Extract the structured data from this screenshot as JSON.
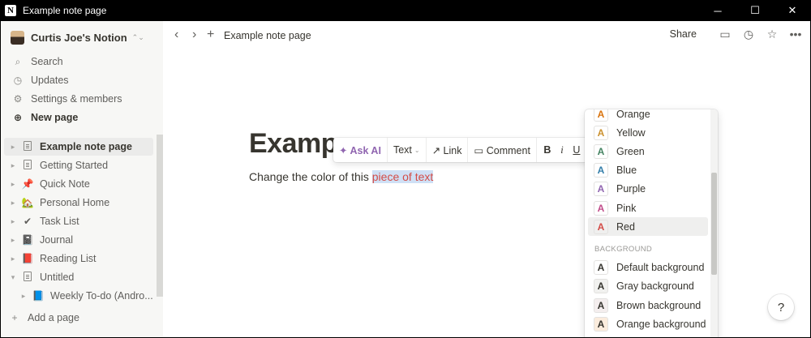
{
  "window": {
    "title": "Example note page",
    "app_icon": "N",
    "controls": {
      "minimize": "─",
      "maximize": "☐",
      "close": "✕"
    }
  },
  "sidebar": {
    "workspace_name": "Curtis Joe's Notion",
    "workspace_chevron": "⌃⌄",
    "top_items": [
      {
        "label": "Search",
        "icon": "search-icon",
        "glyph": "⌕"
      },
      {
        "label": "Updates",
        "icon": "clock-icon",
        "glyph": "◷"
      },
      {
        "label": "Settings & members",
        "icon": "gear-icon",
        "glyph": "⚙"
      },
      {
        "label": "New page",
        "icon": "plus-circle-icon",
        "glyph": "⊕"
      }
    ],
    "pages": [
      {
        "label": "Example note page",
        "glyph": "",
        "active": true
      },
      {
        "label": "Getting Started",
        "glyph": ""
      },
      {
        "label": "Quick Note",
        "glyph": "📌"
      },
      {
        "label": "Personal Home",
        "glyph": "🏡"
      },
      {
        "label": "Task List",
        "glyph": "✔"
      },
      {
        "label": "Journal",
        "glyph": "📓"
      },
      {
        "label": "Reading List",
        "glyph": "📕"
      },
      {
        "label": "Untitled",
        "glyph": ""
      },
      {
        "label": "Weekly To-do (Andro...",
        "glyph": "📘"
      }
    ],
    "add_page": "Add a page",
    "add_glyph": "+"
  },
  "topbar": {
    "back": "‹",
    "forward": "›",
    "new": "+",
    "breadcrumb": "Example note page",
    "share": "Share",
    "icons": {
      "comments": "▭",
      "history": "◷",
      "favorite": "☆",
      "more": "•••"
    }
  },
  "page": {
    "title": "Examp",
    "body_prefix": "Change the color of this ",
    "body_selected": "piece of text"
  },
  "format_toolbar": {
    "ask_ai": "✦ Ask AI",
    "text_type": "Text",
    "type_chevron": "⌄",
    "link": "↗ Link",
    "comment": "▭ Comment",
    "bold": "B",
    "italic": "i",
    "underline": "U"
  },
  "color_menu": {
    "swatch_letter": "A",
    "text_colors": [
      {
        "label": "Orange",
        "color": "#d9730d"
      },
      {
        "label": "Yellow",
        "color": "#cb912f"
      },
      {
        "label": "Green",
        "color": "#448361"
      },
      {
        "label": "Blue",
        "color": "#337ea9"
      },
      {
        "label": "Purple",
        "color": "#9065b0"
      },
      {
        "label": "Pink",
        "color": "#c14c8a"
      },
      {
        "label": "Red",
        "color": "#d44c47",
        "hover": true
      }
    ],
    "background_header": "BACKGROUND",
    "background_colors": [
      {
        "label": "Default background",
        "bg": "#ffffff"
      },
      {
        "label": "Gray background",
        "bg": "#f1f1ef"
      },
      {
        "label": "Brown background",
        "bg": "#f4eeee"
      },
      {
        "label": "Orange background",
        "bg": "#fbecdd"
      }
    ]
  },
  "help": "?"
}
